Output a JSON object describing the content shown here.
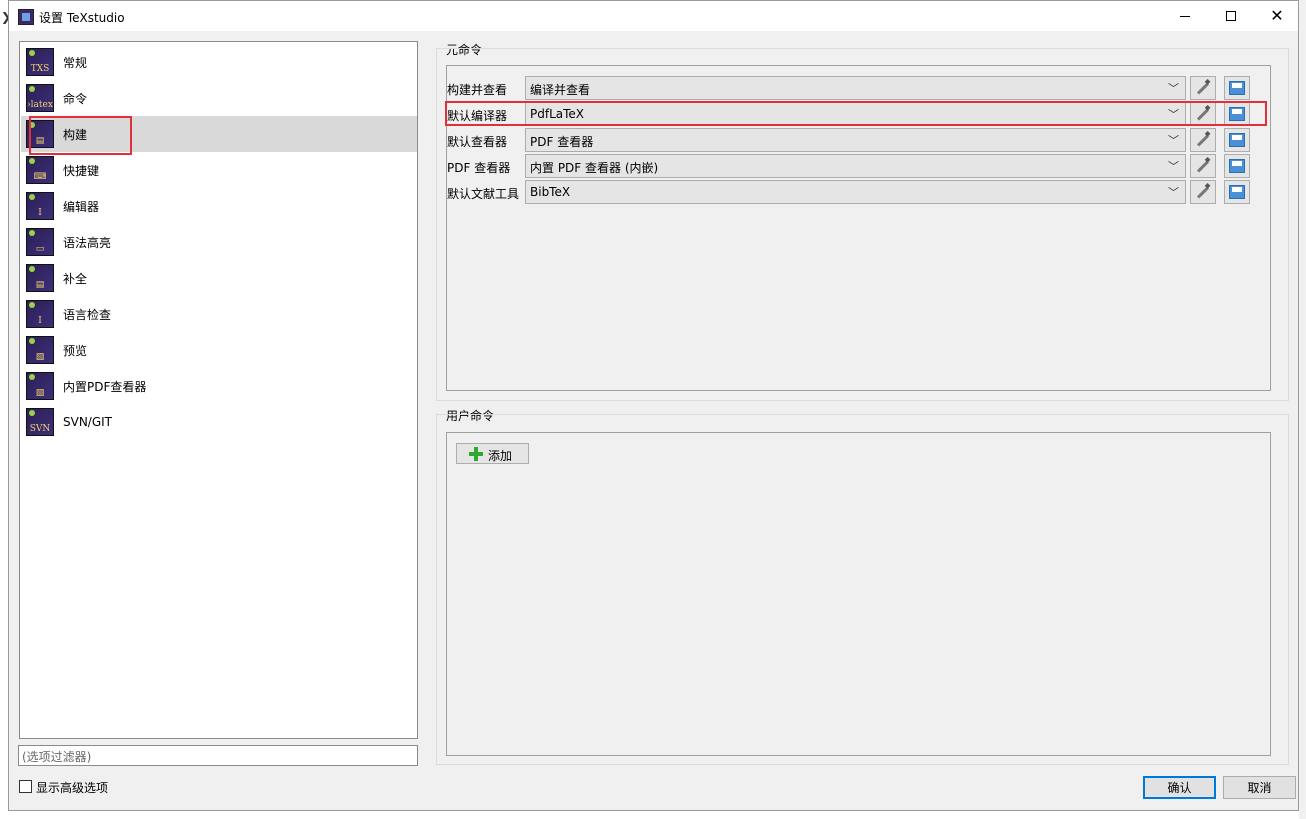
{
  "window": {
    "title": "设置 TeXstudio"
  },
  "sidebar": {
    "items": [
      {
        "label": "常规",
        "icon": "txs-icon",
        "glyph": "TXS"
      },
      {
        "label": "命令",
        "icon": "latex-icon",
        "glyph": "›latex"
      },
      {
        "label": "构建",
        "icon": "build-icon",
        "glyph": "▤",
        "selected": true
      },
      {
        "label": "快捷键",
        "icon": "keyboard-icon",
        "glyph": "⌨"
      },
      {
        "label": "编辑器",
        "icon": "editor-icon",
        "glyph": "I"
      },
      {
        "label": "语法高亮",
        "icon": "syntax-icon",
        "glyph": "▭"
      },
      {
        "label": "补全",
        "icon": "completion-icon",
        "glyph": "▤"
      },
      {
        "label": "语言检查",
        "icon": "spellcheck-icon",
        "glyph": "I"
      },
      {
        "label": "预览",
        "icon": "preview-icon",
        "glyph": "▧"
      },
      {
        "label": "内置PDF查看器",
        "icon": "pdf-viewer-icon",
        "glyph": "▧"
      },
      {
        "label": "SVN/GIT",
        "icon": "svn-icon",
        "glyph": "SVN"
      }
    ],
    "filter_placeholder": "(选项过滤器)",
    "advanced_label": "显示高级选项"
  },
  "meta_commands": {
    "group_title": "元命令",
    "rows": [
      {
        "label": "构建并查看",
        "value": "编译并查看"
      },
      {
        "label": "默认编译器",
        "value": "PdfLaTeX"
      },
      {
        "label": "默认查看器",
        "value": "PDF 查看器"
      },
      {
        "label": "PDF 查看器",
        "value": "内置 PDF 查看器 (内嵌)"
      },
      {
        "label": "默认文献工具",
        "value": "BibTeX"
      }
    ]
  },
  "user_commands": {
    "group_title": "用户命令",
    "add_label": "添加"
  },
  "footer": {
    "ok_label": "确认",
    "cancel_label": "取消"
  },
  "colors": {
    "highlight": "#e0303a",
    "selected_bg": "#d9d9d9",
    "focus": "#0078d7"
  }
}
